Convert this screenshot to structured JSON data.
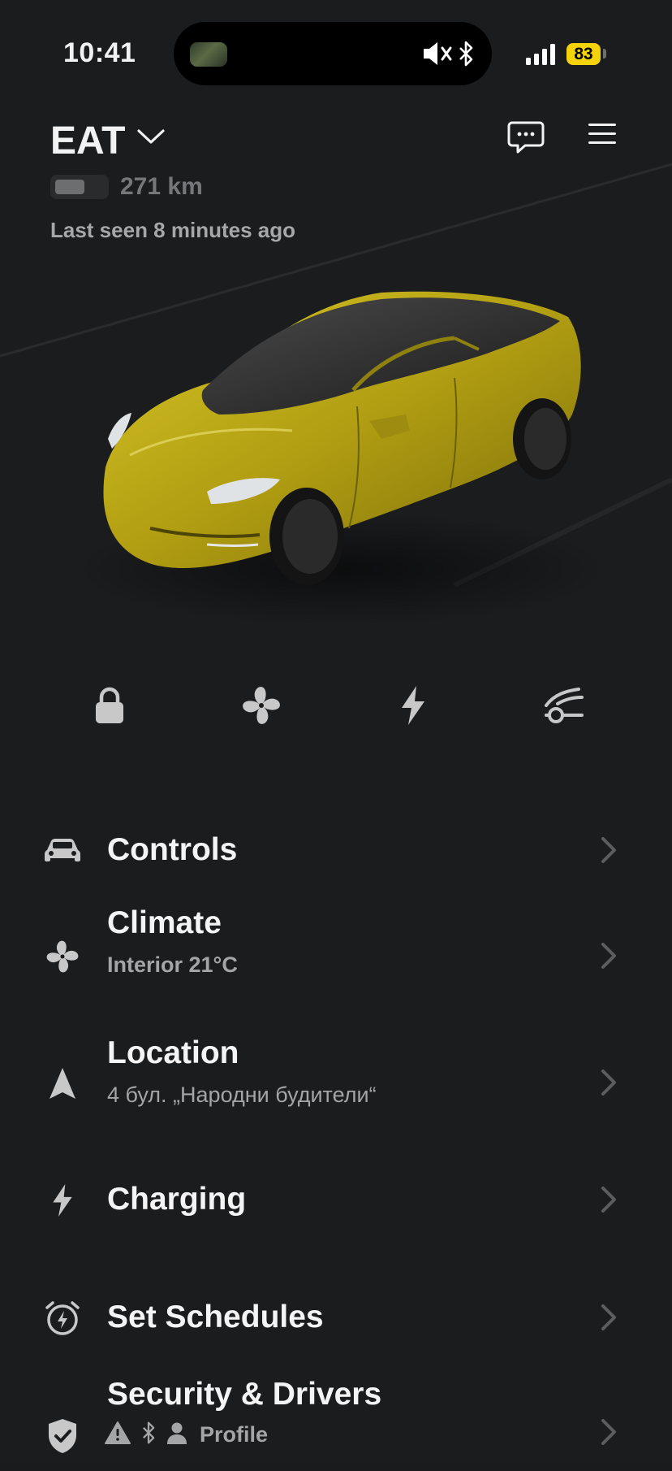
{
  "status_bar": {
    "time": "10:41",
    "battery_percent": "83",
    "icons": [
      "silent-mode-icon",
      "bluetooth-icon",
      "cellular-signal-icon",
      "battery-icon"
    ]
  },
  "header": {
    "vehicle_name": "EAT",
    "range": "271 km",
    "battery_level": 0.6,
    "last_seen": "Last seen 8 minutes ago",
    "icons": [
      "chevron-down-icon",
      "message-icon",
      "hamburger-menu-icon"
    ]
  },
  "car": {
    "paint_color": "#c9b418"
  },
  "quick_actions": [
    {
      "icon": "lock-icon"
    },
    {
      "icon": "fan-icon"
    },
    {
      "icon": "lightning-icon"
    },
    {
      "icon": "frunk-icon"
    }
  ],
  "menu": {
    "controls": {
      "title": "Controls",
      "icon": "car-icon"
    },
    "climate": {
      "title": "Climate",
      "subtitle": "Interior 21°C",
      "icon": "fan-icon"
    },
    "location": {
      "title": "Location",
      "subtitle": "4 бул. „Народни будители“",
      "icon": "navigation-arrow-icon"
    },
    "charging": {
      "title": "Charging",
      "icon": "lightning-icon"
    },
    "schedules": {
      "title": "Set Schedules",
      "icon": "alarm-clock-icon"
    },
    "security": {
      "title": "Security & Drivers",
      "subtitle": "Profile",
      "icon": "shield-check-icon"
    }
  },
  "colors": {
    "background": "#1b1c1e",
    "text_primary": "#f4f4f4",
    "text_secondary": "#a4a5a7",
    "icon_gray": "#c8c8c8",
    "battery_pill": "#f5d30b"
  }
}
